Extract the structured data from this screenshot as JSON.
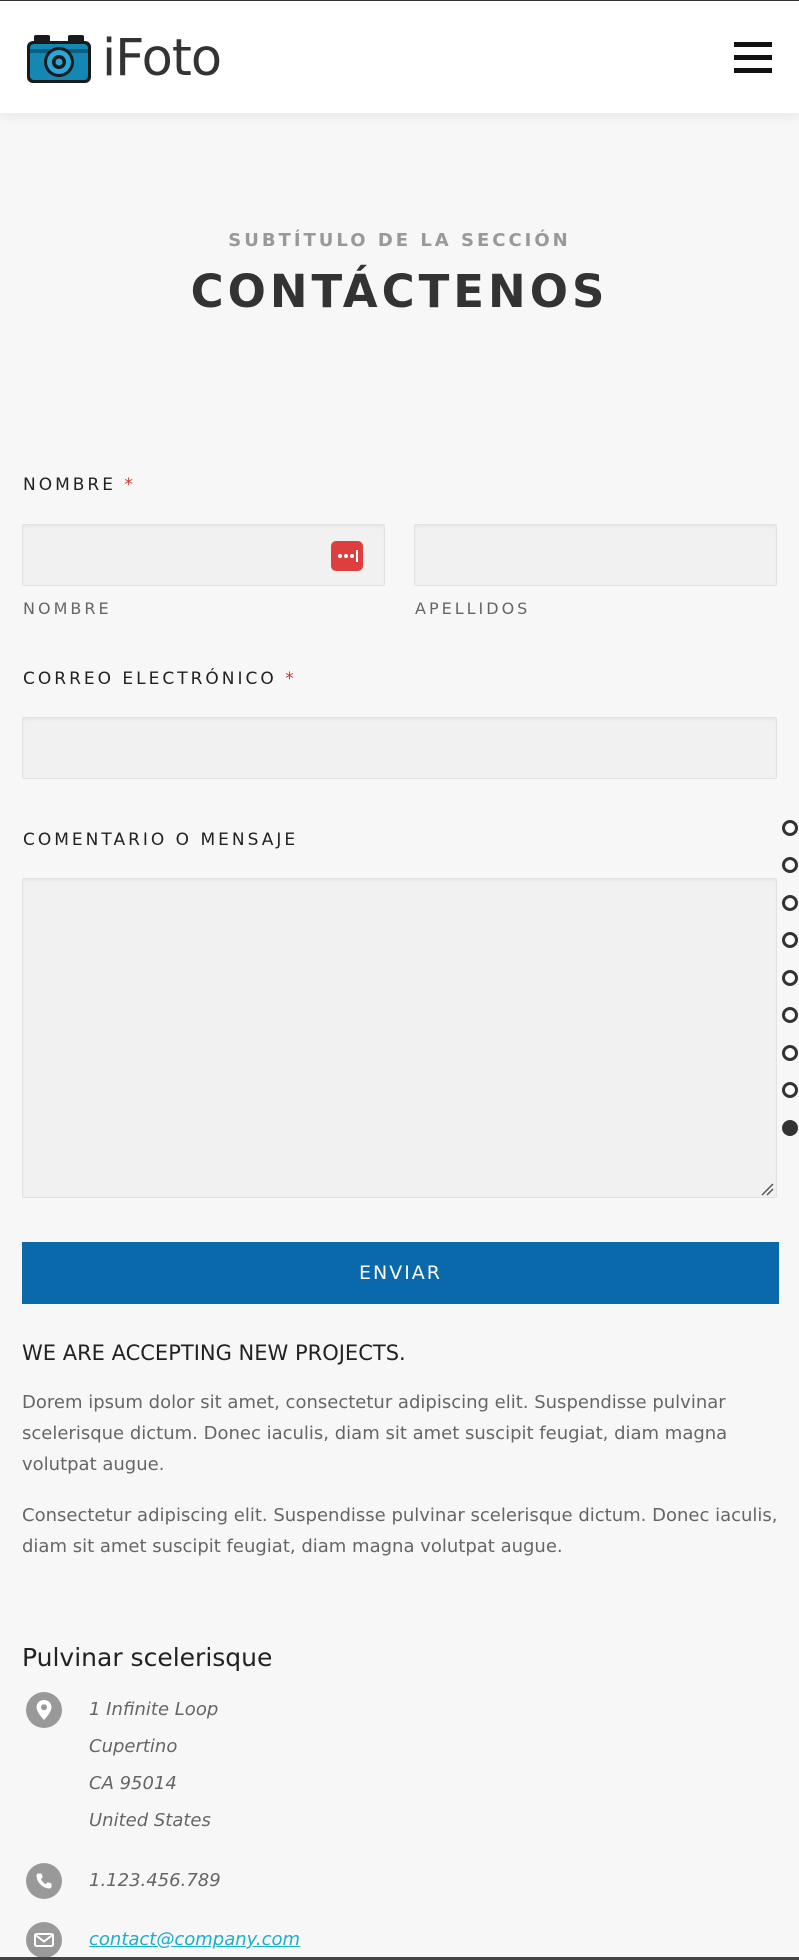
{
  "header": {
    "logo_text": "iFoto",
    "logo_icon": "camera-icon",
    "menu_icon": "hamburger-menu-icon"
  },
  "section": {
    "subtitle": "SUBTÍTULO DE LA SECCIÓN",
    "title": "CONTÁCTENOS"
  },
  "form": {
    "name_label": "NOMBRE",
    "required_mark": "*",
    "first_name_sublabel": "NOMBRE",
    "last_name_sublabel": "APELLIDOS",
    "email_label": "CORREO ELECTRÓNICO",
    "message_label": "COMENTARIO O MENSAJE",
    "submit_label": "ENVIAR",
    "first_name_value": "",
    "last_name_value": "",
    "email_value": "",
    "message_value": ""
  },
  "side_nav": {
    "dot_count": 9,
    "active_index": 8
  },
  "info": {
    "heading": "WE ARE ACCEPTING NEW PROJECTS.",
    "paragraph1": "Dorem ipsum dolor sit amet, consectetur adipiscing elit. Suspendisse pulvinar scelerisque dictum. Donec iaculis, diam sit amet suscipit feugiat, diam magna volutpat augue.",
    "paragraph2": "Consectetur adipiscing elit. Suspendisse pulvinar scelerisque dictum. Donec iaculis, diam sit amet suscipit feugiat, diam magna volutpat augue."
  },
  "contact": {
    "heading": "Pulvinar scelerisque",
    "address": [
      "1 Infinite Loop",
      "Cupertino",
      "CA 95014",
      "United States"
    ],
    "phone": "1.123.456.789",
    "email": "contact@company.com"
  },
  "colors": {
    "accent": "#0a69ab",
    "required": "#c0392b",
    "link": "#1ab0c8",
    "password_manager": "#df3e3e"
  }
}
